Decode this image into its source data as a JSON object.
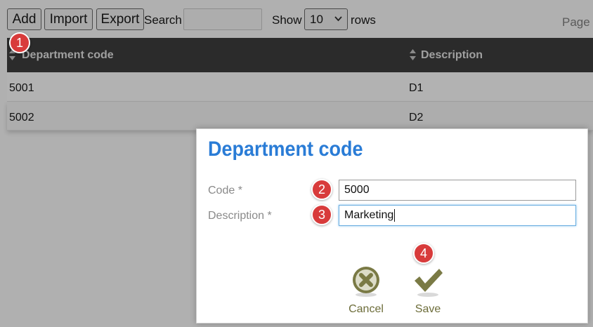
{
  "toolbar": {
    "add_label": "Add",
    "import_label": "Import",
    "export_label": "Export",
    "search_label": "Search",
    "search_value": "",
    "show_label": "Show",
    "rows_per_page": "10",
    "rows_label": "rows",
    "page_label": "Page"
  },
  "table": {
    "columns": [
      "Department code",
      "Description"
    ],
    "rows": [
      {
        "code": "5001",
        "description": "D1"
      },
      {
        "code": "5002",
        "description": "D2"
      }
    ]
  },
  "markers": [
    "1",
    "2",
    "3",
    "4"
  ],
  "dialog": {
    "title": "Department code",
    "code_label": "Code *",
    "code_value": "5000",
    "description_label": "Description *",
    "description_value": "Marketing",
    "cancel_label": "Cancel",
    "save_label": "Save"
  },
  "colors": {
    "accent": "#2a7cd6",
    "marker": "#d83b3b",
    "header_bg": "#2b2b2b",
    "action_icon": "#7a7a45"
  },
  "icons": [
    "search-icon",
    "chevron-down-icon",
    "sort-icon",
    "cancel-x-icon",
    "save-check-icon"
  ]
}
